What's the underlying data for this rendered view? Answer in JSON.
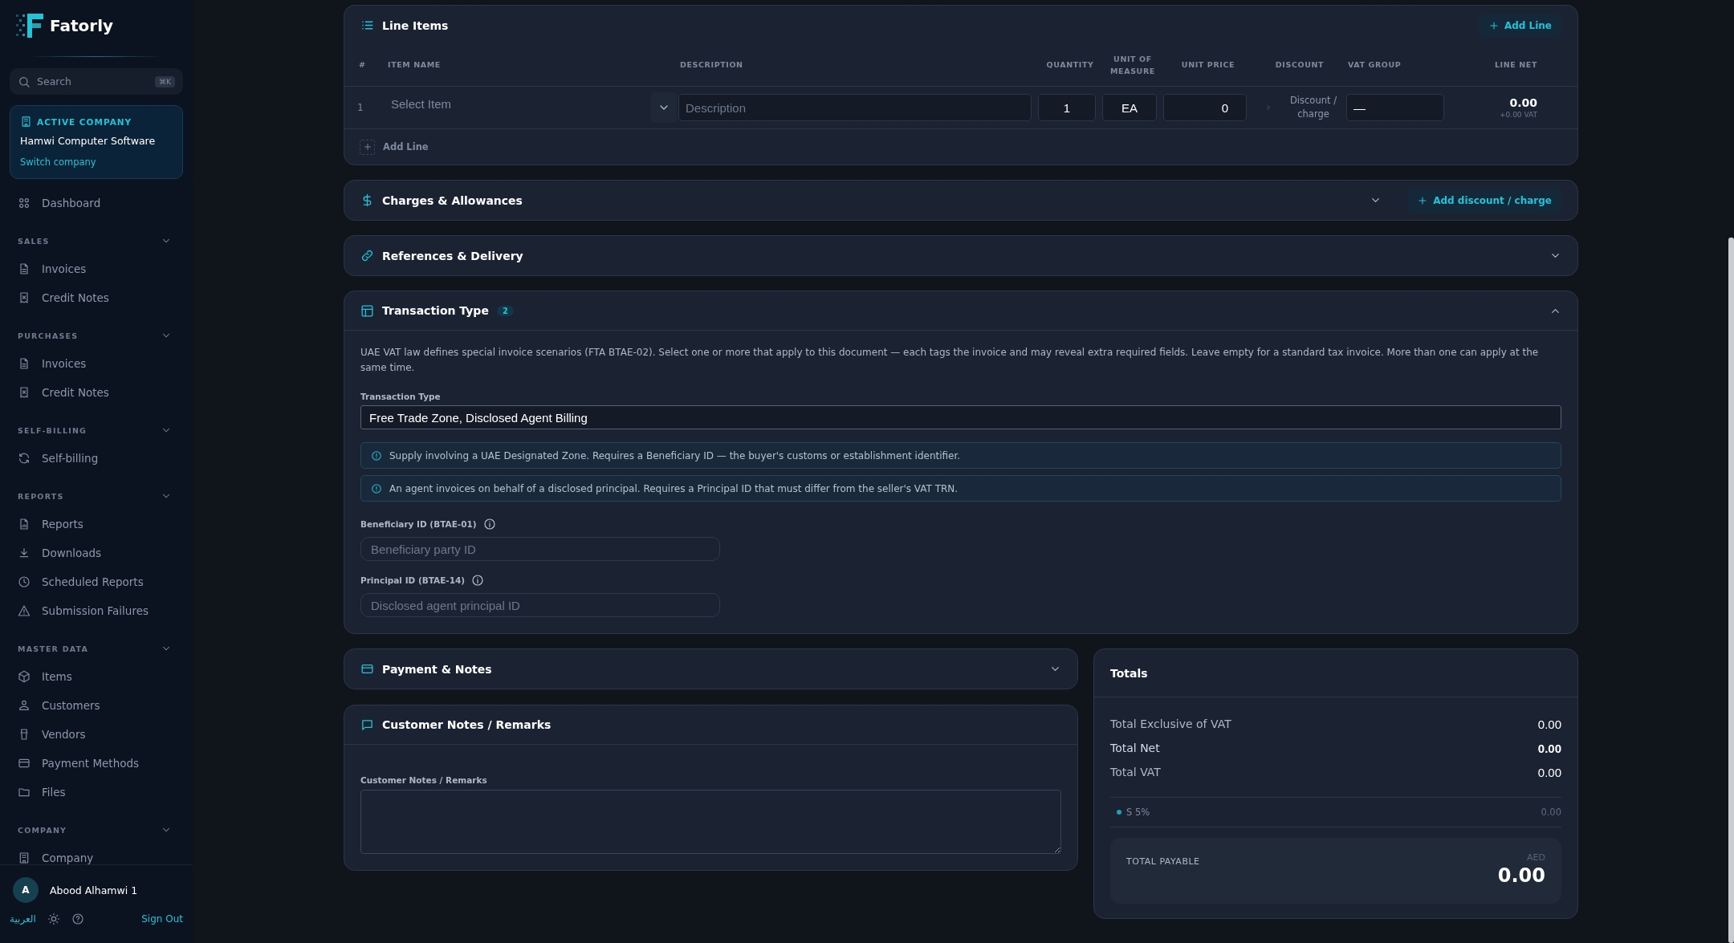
{
  "sidebar": {
    "logo": "Fatorly",
    "search": {
      "placeholder": "Search",
      "shortcut": "⌘K"
    },
    "company": {
      "label": "ACTIVE COMPANY",
      "name": "Hamwi Computer Software",
      "link": "Switch company"
    },
    "nav": [
      {
        "label": "Dashboard"
      },
      {
        "group": "SALES",
        "expanded": true,
        "items": [
          {
            "label": "Invoices"
          },
          {
            "label": "Credit Notes"
          }
        ]
      },
      {
        "group": "PURCHASES",
        "expanded": true,
        "items": [
          {
            "label": "Invoices"
          },
          {
            "label": "Credit Notes"
          }
        ]
      },
      {
        "group": "SELF-BILLING",
        "expanded": true,
        "items": [
          {
            "label": "Self-billing"
          }
        ]
      },
      {
        "group": "REPORTS",
        "expanded": true,
        "items": [
          {
            "label": "Reports"
          },
          {
            "label": "Downloads"
          },
          {
            "label": "Scheduled Reports"
          },
          {
            "label": "Submission Failures"
          }
        ]
      },
      {
        "group": "MASTER DATA",
        "expanded": true,
        "items": [
          {
            "label": "Items"
          },
          {
            "label": "Customers"
          },
          {
            "label": "Vendors"
          },
          {
            "label": "Payment Methods"
          },
          {
            "label": "Files"
          }
        ]
      },
      {
        "group": "COMPANY",
        "expanded": true,
        "items": [
          {
            "label": "Company"
          }
        ]
      }
    ],
    "user": {
      "initial": "A",
      "name": "Abood Alhamwi 1"
    },
    "footer": {
      "language": "العربية",
      "sign_out": "Sign Out"
    }
  },
  "line_items": {
    "title": "Line Items",
    "add_button": "Add Line",
    "columns": [
      "#",
      "ITEM NAME",
      "DESCRIPTION",
      "QUANTITY",
      "UNIT OF MEASURE",
      "UNIT PRICE",
      "DISCOUNT",
      "VAT GROUP",
      "LINE NET"
    ],
    "rows": [
      {
        "number": "1",
        "item_placeholder": "Select Item",
        "description_placeholder": "Description",
        "quantity": "1",
        "unit": "EA",
        "unit_price": "0",
        "discount": "Discount / charge",
        "vat_group": "—",
        "line_net": "0.00",
        "line_vat": "+0.00 VAT"
      }
    ],
    "footer_add": "Add Line"
  },
  "sections": [
    {
      "kind": "charges",
      "title": "Charges & Allowances",
      "expanded": false,
      "action": "Add discount / charge"
    },
    {
      "kind": "references",
      "title": "References & Delivery",
      "expanded": false
    },
    {
      "kind": "transaction",
      "title": "Transaction Type",
      "badge": "2",
      "expanded": true,
      "intro": "UAE VAT law defines special invoice scenarios (FTA BTAE-02). Select one or more that apply to this document — each tags the invoice and may reveal extra required fields. Leave empty for a standard tax invoice. More than one can apply at the same time.",
      "field_label": "Transaction Type",
      "value": "Free Trade Zone, Disclosed Agent Billing",
      "notices": [
        "Supply involving a UAE Designated Zone. Requires a Beneficiary ID — the buyer's customs or establishment identifier.",
        "An agent invoices on behalf of a disclosed principal. Requires a Principal ID that must differ from the seller's VAT TRN."
      ],
      "fields": [
        {
          "label": "Beneficiary ID (BTAE-01)",
          "placeholder": "Beneficiary party ID"
        },
        {
          "label": "Principal ID (BTAE-14)",
          "placeholder": "Disclosed agent principal ID"
        }
      ]
    }
  ],
  "payment": {
    "title": "Payment & Notes",
    "expanded": false
  },
  "notes": {
    "title": "Customer Notes / Remarks",
    "field_label": "Customer Notes / Remarks"
  },
  "totals": {
    "title": "Totals",
    "rows": [
      {
        "label": "Total Exclusive of VAT",
        "value": "0.00",
        "bold": false
      },
      {
        "label": "Total Net",
        "value": "0.00",
        "bold": true
      },
      {
        "label": "Total VAT",
        "value": "0.00",
        "bold": false
      }
    ],
    "breakdown": [
      {
        "label": "S 5%",
        "value": "0.00",
        "color": "#1fa2b5"
      }
    ],
    "payable_label": "TOTAL PAYABLE",
    "currency": "AED",
    "payable": "0.00"
  }
}
